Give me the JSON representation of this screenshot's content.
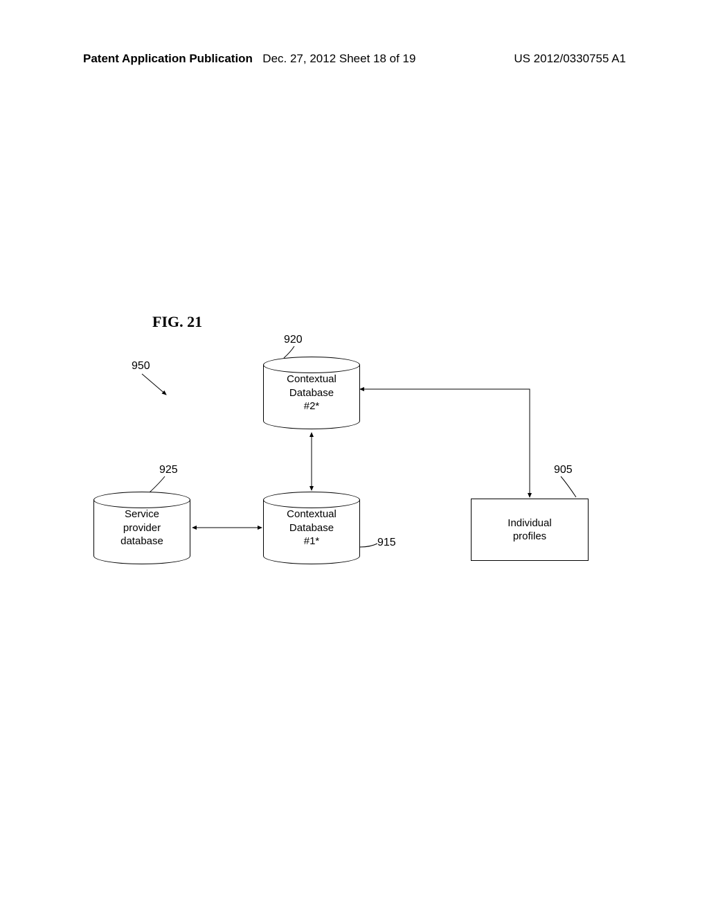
{
  "header": {
    "left": "Patent Application Publication",
    "center": "Dec. 27, 2012  Sheet 18 of 19",
    "right": "US 2012/0330755 A1"
  },
  "figure": {
    "title": "FIG. 21"
  },
  "components": {
    "db920": {
      "label": "Contextual\nDatabase\n#2*",
      "ref": "920"
    },
    "db915": {
      "label": "Contextual\nDatabase\n#1*",
      "ref": "915"
    },
    "db925": {
      "label": "Service\nprovider\ndatabase",
      "ref": "925"
    },
    "box905": {
      "label": "Individual\nprofiles",
      "ref": "905"
    },
    "ref950": "950"
  }
}
